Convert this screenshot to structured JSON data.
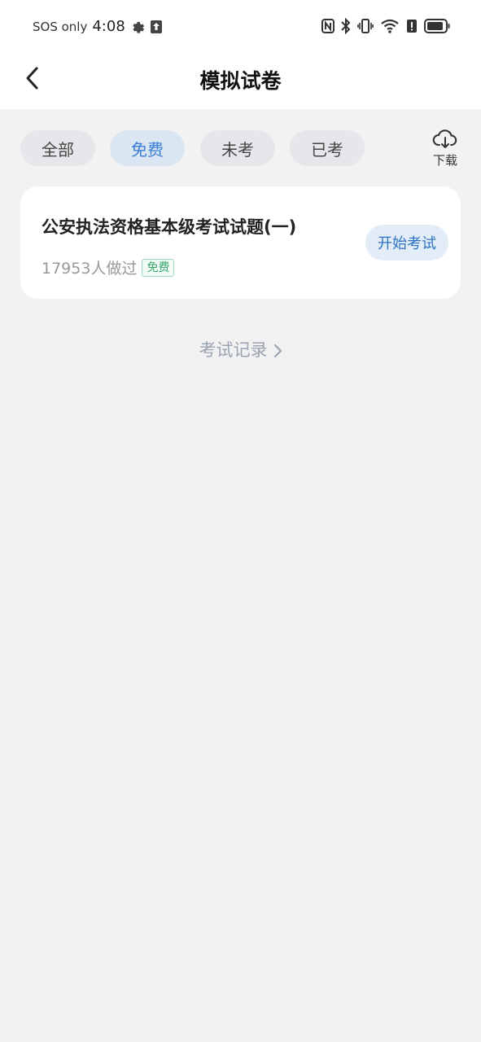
{
  "status_bar": {
    "carrier": "SOS only",
    "time": "4:08",
    "icons": [
      "settings-icon",
      "upload-icon",
      "nfc-icon",
      "bluetooth-icon",
      "vibrate-icon",
      "wifi-icon",
      "alert-icon",
      "battery-icon"
    ]
  },
  "header": {
    "title": "模拟试卷",
    "back_icon": "chevron-left-icon"
  },
  "filters": {
    "tabs": [
      {
        "label": "全部",
        "active": false
      },
      {
        "label": "免费",
        "active": true
      },
      {
        "label": "未考",
        "active": false
      },
      {
        "label": "已考",
        "active": false
      }
    ],
    "download_label": "下载",
    "download_icon": "cloud-download-icon"
  },
  "exams": [
    {
      "title": "公安执法资格基本级考试试题(一)",
      "count": "17953人做过",
      "badge": "免费",
      "action": "开始考试"
    }
  ],
  "records": {
    "label": "考试记录",
    "icon": "chevron-right-icon"
  },
  "colors": {
    "accent": "#3a7ed6",
    "background": "#f2f2f2",
    "badge_green": "#3aa56d"
  }
}
